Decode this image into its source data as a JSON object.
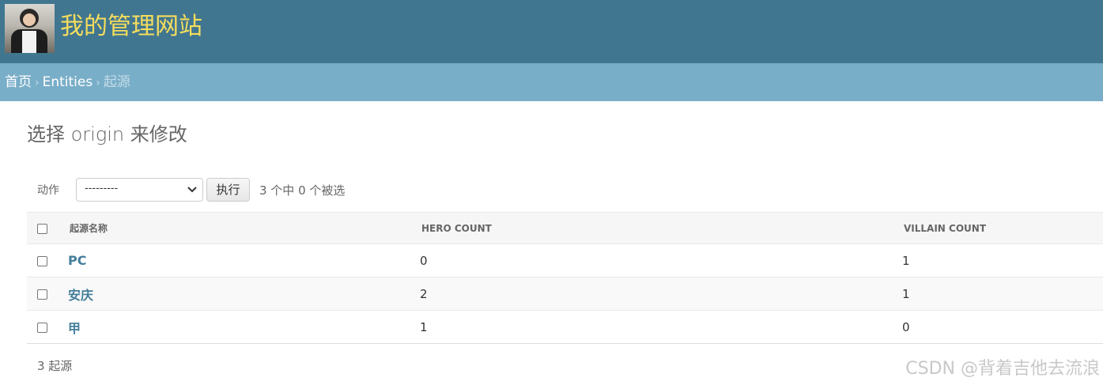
{
  "header": {
    "site_title": "我的管理网站"
  },
  "breadcrumbs": {
    "home": "首页",
    "sep": "›",
    "app": "Entities",
    "current": "起源"
  },
  "page": {
    "heading": "选择 origin 来修改"
  },
  "actions": {
    "label": "动作",
    "selected_option": "---------",
    "go_label": "执行",
    "counter": "3 个中 0 个被选"
  },
  "table": {
    "columns": [
      "起源名称",
      "HERO COUNT",
      "VILLAIN COUNT"
    ],
    "rows": [
      {
        "name": "PC",
        "hero_count": "0",
        "villain_count": "1"
      },
      {
        "name": "安庆",
        "hero_count": "2",
        "villain_count": "1"
      },
      {
        "name": "甲",
        "hero_count": "1",
        "villain_count": "0"
      }
    ]
  },
  "paginator": {
    "text": "3 起源"
  },
  "watermark": {
    "text": "CSDN @背着吉他去流浪"
  },
  "colors": {
    "header_bg": "#417690",
    "breadcrumb_bg": "#79aec8",
    "site_title": "#f5dd5d",
    "link": "#447e9b"
  }
}
